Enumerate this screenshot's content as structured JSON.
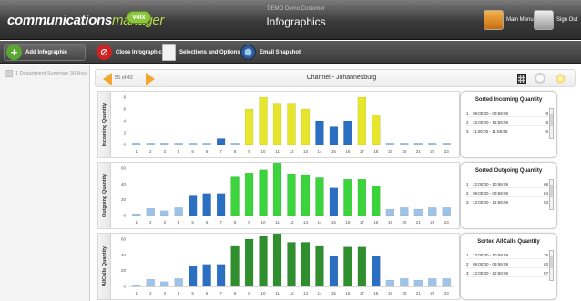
{
  "header": {
    "logo_primary": "communications",
    "logo_secondary": "manager",
    "logo_badge": "voix",
    "customer_name": "DEMO Demo Customer",
    "app_title": "Infographics",
    "main_menu_label": "Main Menu",
    "sign_out_label": "Sign Out"
  },
  "toolbar": {
    "add_label": "Add Infographic",
    "close_label": "Close Infographic",
    "selections_label": "Selections and Options",
    "snapshot_label": "Email Snapshot"
  },
  "sidebar": {
    "items": [
      {
        "label": "1 Department Summary 30 Hour"
      }
    ]
  },
  "nav": {
    "page_indicator": "55 of 42",
    "channel_title": "Channel - Johannesburg"
  },
  "colors": {
    "incoming_bar": "#e6e62c",
    "outgoing_bar": "#3cd43c",
    "allcalls_bar": "#2f8f2f",
    "low_bar": "#2a6fc2",
    "min_bar": "#9ec3e8",
    "accent_orange": "#f3a630"
  },
  "panels": [
    {
      "ylabel": "Incoming Quantity",
      "side_title": "Sorted Incoming Quantity",
      "rows": [
        {
          "rank": "1",
          "time": "09:00:00 - 09:59:59",
          "value": "8"
        },
        {
          "rank": "2",
          "time": "15:00:00 - 15:59:59",
          "value": "8"
        },
        {
          "rank": "3",
          "time": "11:00:00 - 11:59:59",
          "value": "6"
        }
      ]
    },
    {
      "ylabel": "Outgoing Quantity",
      "side_title": "Sorted Outgoing Quantity",
      "rows": [
        {
          "rank": "1",
          "time": "12:00:00 - 10:59:59",
          "value": "68"
        },
        {
          "rank": "2",
          "time": "09:00:00 - 09:59:59",
          "value": "54"
        },
        {
          "rank": "3",
          "time": "12:00:00 - 12:59:59",
          "value": "53"
        }
      ]
    },
    {
      "ylabel": "AllCalls Quantity",
      "side_title": "Sorted AllCalls Quantity",
      "rows": [
        {
          "rank": "1",
          "time": "12:00:00 - 10:59:59",
          "value": "76"
        },
        {
          "rank": "2",
          "time": "09:00:00 - 09:59:59",
          "value": "63"
        },
        {
          "rank": "3",
          "time": "12:00:00 - 12:59:59",
          "value": "57"
        }
      ]
    }
  ],
  "chart_data": [
    {
      "type": "bar",
      "categories": [
        "1",
        "2",
        "3",
        "4",
        "5",
        "6",
        "7",
        "8",
        "9",
        "10",
        "11",
        "12",
        "13",
        "14",
        "15",
        "16",
        "17",
        "18",
        "19",
        "20",
        "21",
        "22",
        "23"
      ],
      "values": [
        0,
        0,
        0,
        0,
        0,
        0,
        1,
        0,
        6,
        8,
        7,
        7,
        6,
        4,
        3,
        4,
        8,
        5,
        0,
        0,
        0,
        0,
        0
      ],
      "ylim": [
        0,
        8
      ],
      "yticks": [
        0,
        2,
        4,
        6,
        8
      ],
      "ylabel": "Incoming Quantity"
    },
    {
      "type": "bar",
      "categories": [
        "1",
        "2",
        "3",
        "4",
        "5",
        "6",
        "7",
        "8",
        "9",
        "10",
        "11",
        "12",
        "13",
        "14",
        "15",
        "16",
        "17",
        "18",
        "19",
        "20",
        "21",
        "22",
        "23"
      ],
      "values": [
        2,
        9,
        6,
        10,
        26,
        28,
        28,
        49,
        54,
        58,
        68,
        53,
        52,
        48,
        35,
        46,
        46,
        38,
        8,
        10,
        8,
        10,
        10
      ],
      "ylim": [
        0,
        60
      ],
      "yticks": [
        0,
        20,
        40,
        60
      ],
      "ylabel": "Outgoing Quantity"
    },
    {
      "type": "bar",
      "categories": [
        "1",
        "2",
        "3",
        "4",
        "5",
        "6",
        "7",
        "8",
        "9",
        "10",
        "11",
        "12",
        "13",
        "14",
        "15",
        "16",
        "17",
        "18",
        "19",
        "20",
        "21",
        "22",
        "23"
      ],
      "values": [
        2,
        9,
        6,
        10,
        26,
        28,
        28,
        52,
        60,
        64,
        76,
        56,
        56,
        52,
        38,
        50,
        50,
        39,
        8,
        10,
        8,
        10,
        10
      ],
      "ylim": [
        0,
        60
      ],
      "yticks": [
        0,
        20,
        40,
        60
      ],
      "ylabel": "AllCalls Quantity"
    }
  ]
}
